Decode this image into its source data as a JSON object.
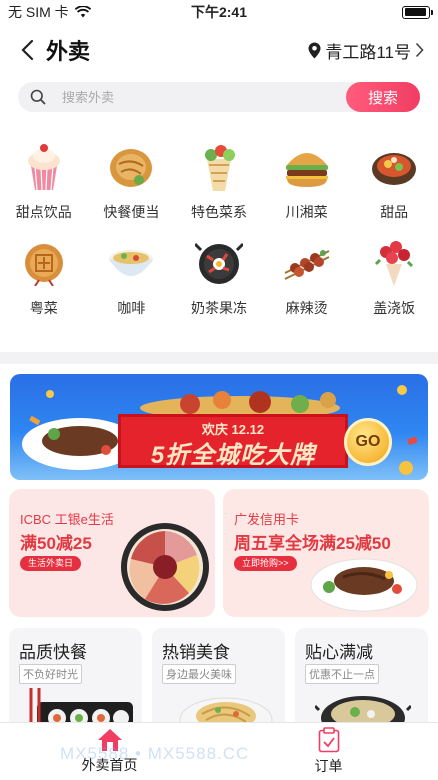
{
  "status_bar": {
    "carrier": "无 SIM 卡",
    "time": "下午2:41",
    "battery_level": 0.95
  },
  "nav": {
    "title": "外卖",
    "location": "青工路11号"
  },
  "search": {
    "placeholder": "搜索外卖",
    "button": "搜索"
  },
  "categories": [
    {
      "label": "甜点饮品",
      "icon": "cupcake-icon"
    },
    {
      "label": "快餐便当",
      "icon": "pancake-icon"
    },
    {
      "label": "特色菜系",
      "icon": "wrap-icon"
    },
    {
      "label": "川湘菜",
      "icon": "burger-icon"
    },
    {
      "label": "甜品",
      "icon": "hotpot-icon"
    },
    {
      "label": "粤菜",
      "icon": "mooncake-icon"
    },
    {
      "label": "咖啡",
      "icon": "noodle-bowl-icon"
    },
    {
      "label": "奶茶果冻",
      "icon": "bibimbap-icon"
    },
    {
      "label": "麻辣烫",
      "icon": "skewer-icon"
    },
    {
      "label": "盖浇饭",
      "icon": "flower-bouquet-icon"
    }
  ],
  "banner": {
    "subtitle": "欢庆 12.12",
    "title": "5折全城吃大牌",
    "button": "GO"
  },
  "promo_cards": [
    {
      "line1": "ICBC 工银e生活",
      "line2": "满50减25",
      "tag": "生活外卖日"
    },
    {
      "line1": "广发信用卡",
      "line2": "周五享全场满25减50",
      "tag": "立即抢购>>"
    }
  ],
  "mini_cards": [
    {
      "title": "品质快餐",
      "subtitle": "不负好时光"
    },
    {
      "title": "热销美食",
      "subtitle": "身边最火美味"
    },
    {
      "title": "贴心满减",
      "subtitle": "优惠不止一点"
    }
  ],
  "tabbar": {
    "home": "外卖首页",
    "orders": "订单"
  },
  "watermark": "MX5588 • MX5588.CC",
  "colors": {
    "accent": "#f23d63",
    "promo_red": "#e23a43",
    "banner_blue": "#2f86f2"
  }
}
